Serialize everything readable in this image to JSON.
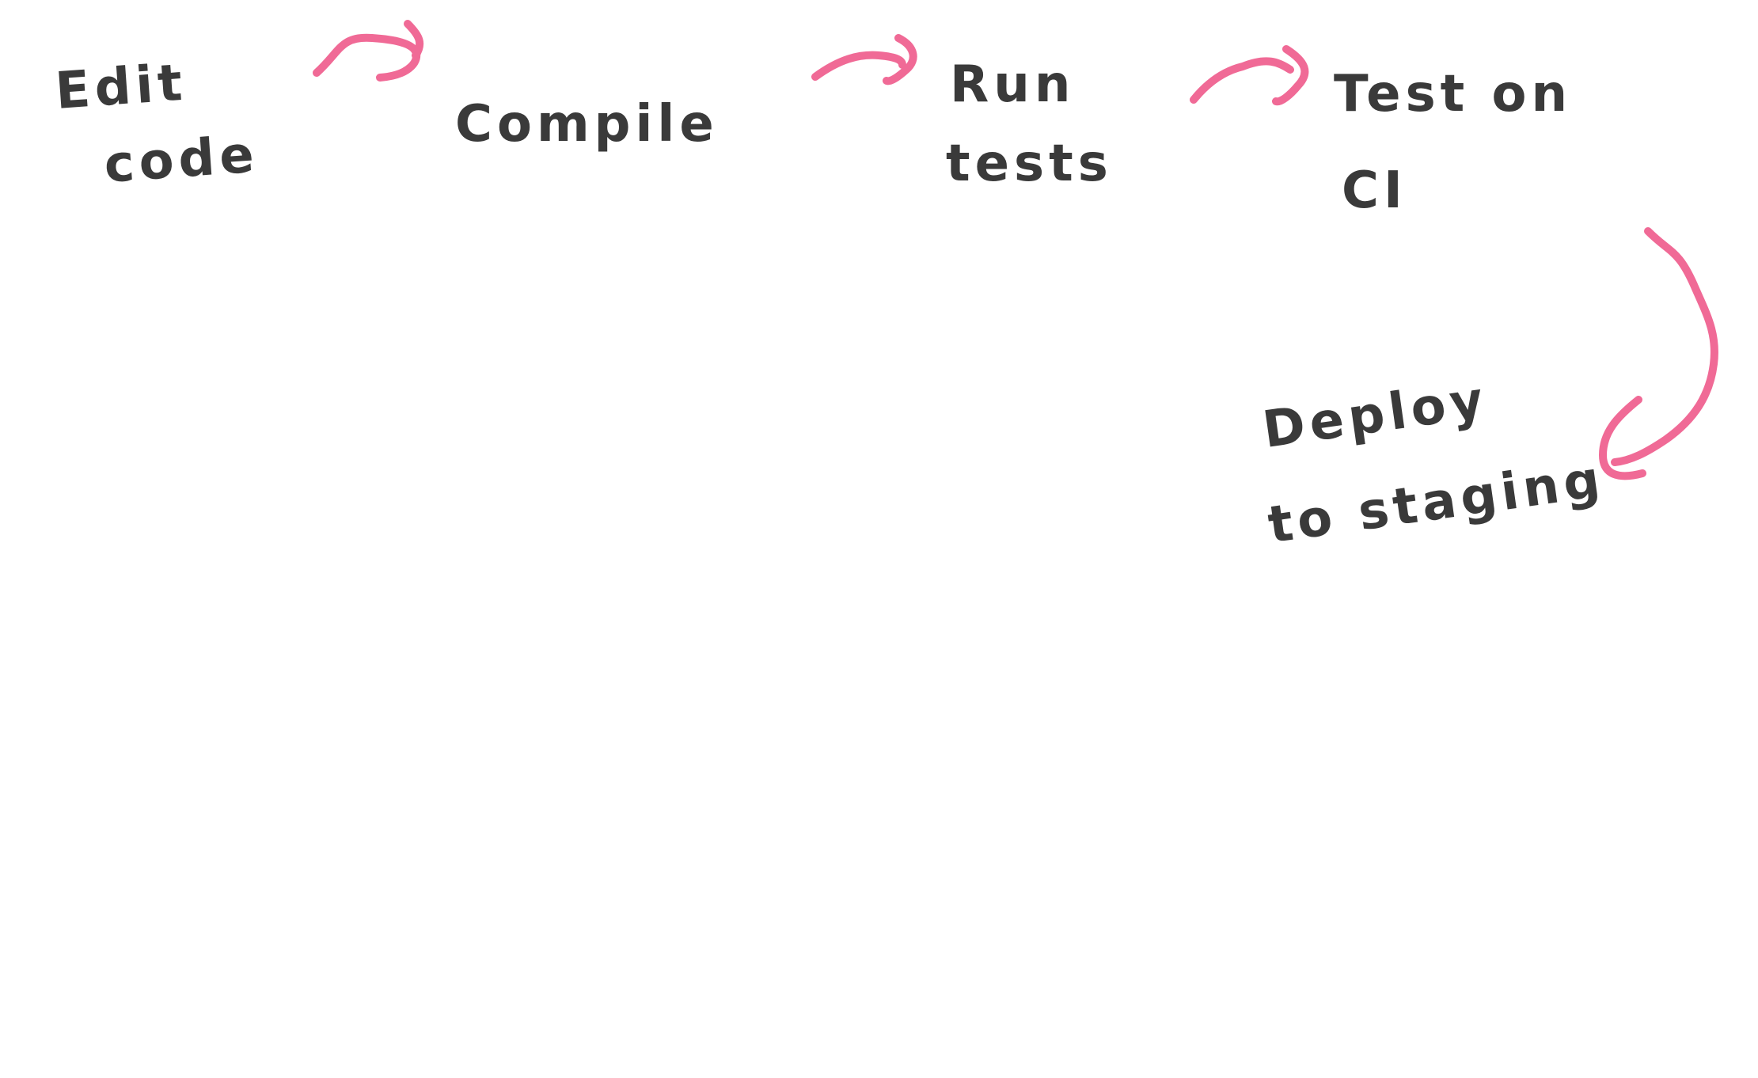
{
  "diagram": {
    "steps": [
      {
        "id": "edit-code",
        "lines": [
          "Edit",
          "code"
        ]
      },
      {
        "id": "compile",
        "lines": [
          "Compile"
        ]
      },
      {
        "id": "run-tests",
        "lines": [
          "Run",
          "tests"
        ]
      },
      {
        "id": "test-on-ci",
        "lines": [
          "Test on",
          "CI"
        ]
      },
      {
        "id": "deploy-to-staging",
        "lines": [
          "Deploy",
          "to staging"
        ]
      }
    ],
    "text_color": "#3a3a3a",
    "arrow_color": "#f06a96",
    "background": "#ffffff"
  }
}
